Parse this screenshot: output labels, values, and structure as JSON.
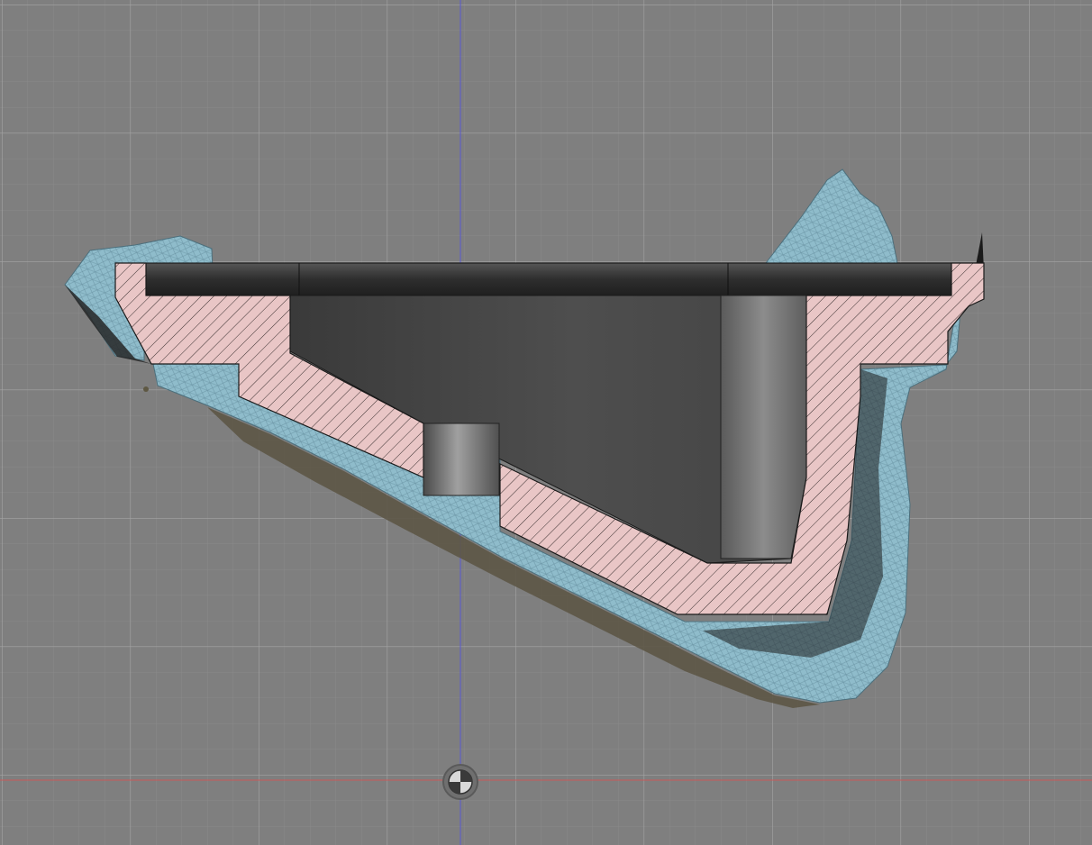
{
  "viewport": {
    "background_color": "#7f7f7f",
    "grid_minor_color": "#8b8b8b",
    "grid_major_color": "#a3a3a3",
    "axis_vertical_color": "#5a5ad0",
    "axis_horizontal_color": "#c85a5a"
  },
  "scene": {
    "scan_mesh_color": "#8fbccb",
    "scan_mesh_line_color": "#6e98a8",
    "scan_underside_color": "#6a604c",
    "section_fill_color": "#e9c6c6",
    "section_hatch_color": "#3a3030",
    "part_dark_color": "#2b2b2b",
    "part_mid_color": "#4a4a4a",
    "part_light_color": "#8a8a8a"
  },
  "origin_icon": "origin-icon"
}
